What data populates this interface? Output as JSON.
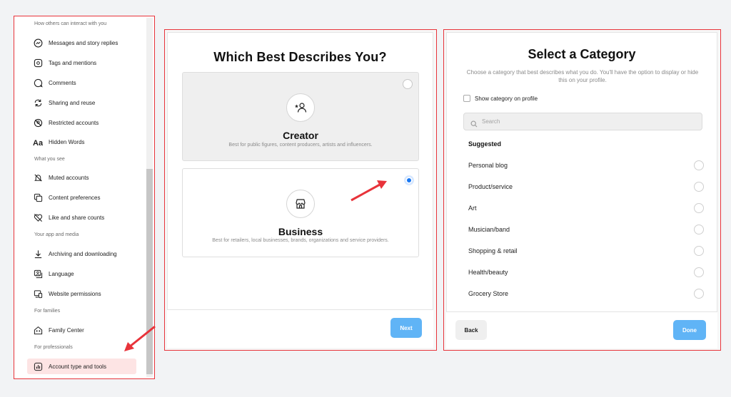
{
  "settings": {
    "sections": [
      {
        "heading": "How others can interact with you",
        "items": [
          {
            "label": "Messages and story replies",
            "icon": "messenger-icon"
          },
          {
            "label": "Tags and mentions",
            "icon": "at-sign-icon"
          },
          {
            "label": "Comments",
            "icon": "comment-icon"
          },
          {
            "label": "Sharing and reuse",
            "icon": "share-reuse-icon"
          },
          {
            "label": "Restricted accounts",
            "icon": "restricted-icon"
          },
          {
            "label": "Hidden Words",
            "icon": "hidden-words-icon"
          }
        ]
      },
      {
        "heading": "What you see",
        "items": [
          {
            "label": "Muted accounts",
            "icon": "muted-bell-icon"
          },
          {
            "label": "Content preferences",
            "icon": "content-preferences-icon"
          },
          {
            "label": "Like and share counts",
            "icon": "like-count-icon"
          }
        ]
      },
      {
        "heading": "Your app and media",
        "items": [
          {
            "label": "Archiving and downloading",
            "icon": "download-icon"
          },
          {
            "label": "Language",
            "icon": "language-icon"
          },
          {
            "label": "Website permissions",
            "icon": "website-permissions-icon"
          }
        ]
      },
      {
        "heading": "For families",
        "items": [
          {
            "label": "Family Center",
            "icon": "family-center-icon"
          }
        ]
      },
      {
        "heading": "For professionals",
        "items": [
          {
            "label": "Account type and tools",
            "icon": "bar-chart-icon",
            "active": true
          }
        ]
      }
    ]
  },
  "describes": {
    "title": "Which Best Describes You?",
    "options": [
      {
        "title": "Creator",
        "description": "Best for public figures, content producers, artists and influencers.",
        "icon": "creator-icon",
        "selected": false
      },
      {
        "title": "Business",
        "description": "Best for retailers, local businesses, brands, organizations and service providers.",
        "icon": "store-icon",
        "selected": true
      }
    ],
    "next_label": "Next"
  },
  "category": {
    "title": "Select a Category",
    "subtitle": "Choose a category that best describes what you do. You'll have the option to display or hide this on your profile.",
    "show_on_profile_label": "Show category on profile",
    "search_placeholder": "Search",
    "suggested_label": "Suggested",
    "items": [
      "Personal blog",
      "Product/service",
      "Art",
      "Musician/band",
      "Shopping & retail",
      "Health/beauty",
      "Grocery Store"
    ],
    "back_label": "Back",
    "done_label": "Done"
  },
  "colors": {
    "annotation_red": "#e8333a",
    "primary_blue": "#1877f2",
    "button_blue": "#60b4f6",
    "active_row": "#fde4e4"
  }
}
